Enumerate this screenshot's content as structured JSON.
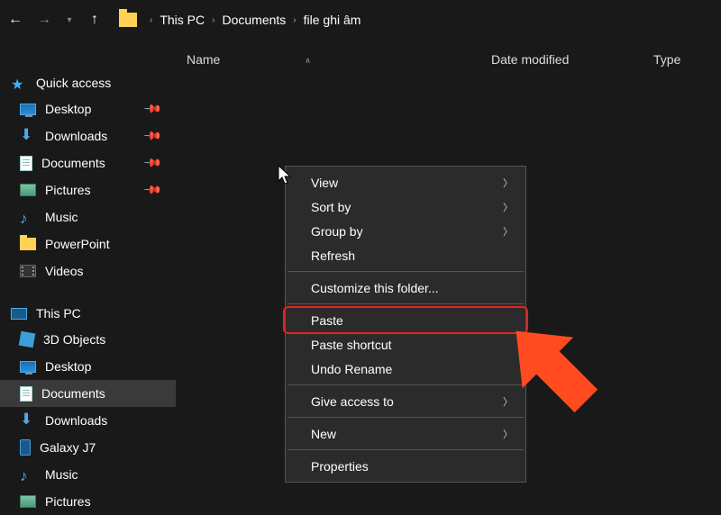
{
  "nav": {
    "back": "←",
    "forward": "→",
    "up": "↑"
  },
  "breadcrumb": {
    "segments": [
      "This PC",
      "Documents",
      "file ghi âm"
    ]
  },
  "columns": {
    "name": "Name",
    "date": "Date modified",
    "type": "Type"
  },
  "sidebar": {
    "quick_access": {
      "label": "Quick access",
      "items": [
        {
          "label": "Desktop",
          "icon": "monitor",
          "pinned": true
        },
        {
          "label": "Downloads",
          "icon": "down",
          "pinned": true
        },
        {
          "label": "Documents",
          "icon": "doc",
          "pinned": true
        },
        {
          "label": "Pictures",
          "icon": "pic",
          "pinned": true
        },
        {
          "label": "Music",
          "icon": "music",
          "pinned": false
        },
        {
          "label": "PowerPoint",
          "icon": "folder",
          "pinned": false
        },
        {
          "label": "Videos",
          "icon": "video",
          "pinned": false
        }
      ]
    },
    "this_pc": {
      "label": "This PC",
      "items": [
        {
          "label": "3D Objects",
          "icon": "3d"
        },
        {
          "label": "Desktop",
          "icon": "monitor"
        },
        {
          "label": "Documents",
          "icon": "doc",
          "selected": true
        },
        {
          "label": "Downloads",
          "icon": "down"
        },
        {
          "label": "Galaxy J7",
          "icon": "phone"
        },
        {
          "label": "Music",
          "icon": "music"
        },
        {
          "label": "Pictures",
          "icon": "pic"
        }
      ]
    }
  },
  "context_menu": {
    "groups": [
      [
        {
          "label": "View",
          "submenu": true
        },
        {
          "label": "Sort by",
          "submenu": true
        },
        {
          "label": "Group by",
          "submenu": true
        },
        {
          "label": "Refresh"
        }
      ],
      [
        {
          "label": "Customize this folder..."
        }
      ],
      [
        {
          "label": "Paste",
          "highlighted": true
        },
        {
          "label": "Paste shortcut"
        },
        {
          "label": "Undo Rename"
        }
      ],
      [
        {
          "label": "Give access to",
          "submenu": true
        }
      ],
      [
        {
          "label": "New",
          "submenu": true
        }
      ],
      [
        {
          "label": "Properties"
        }
      ]
    ]
  }
}
